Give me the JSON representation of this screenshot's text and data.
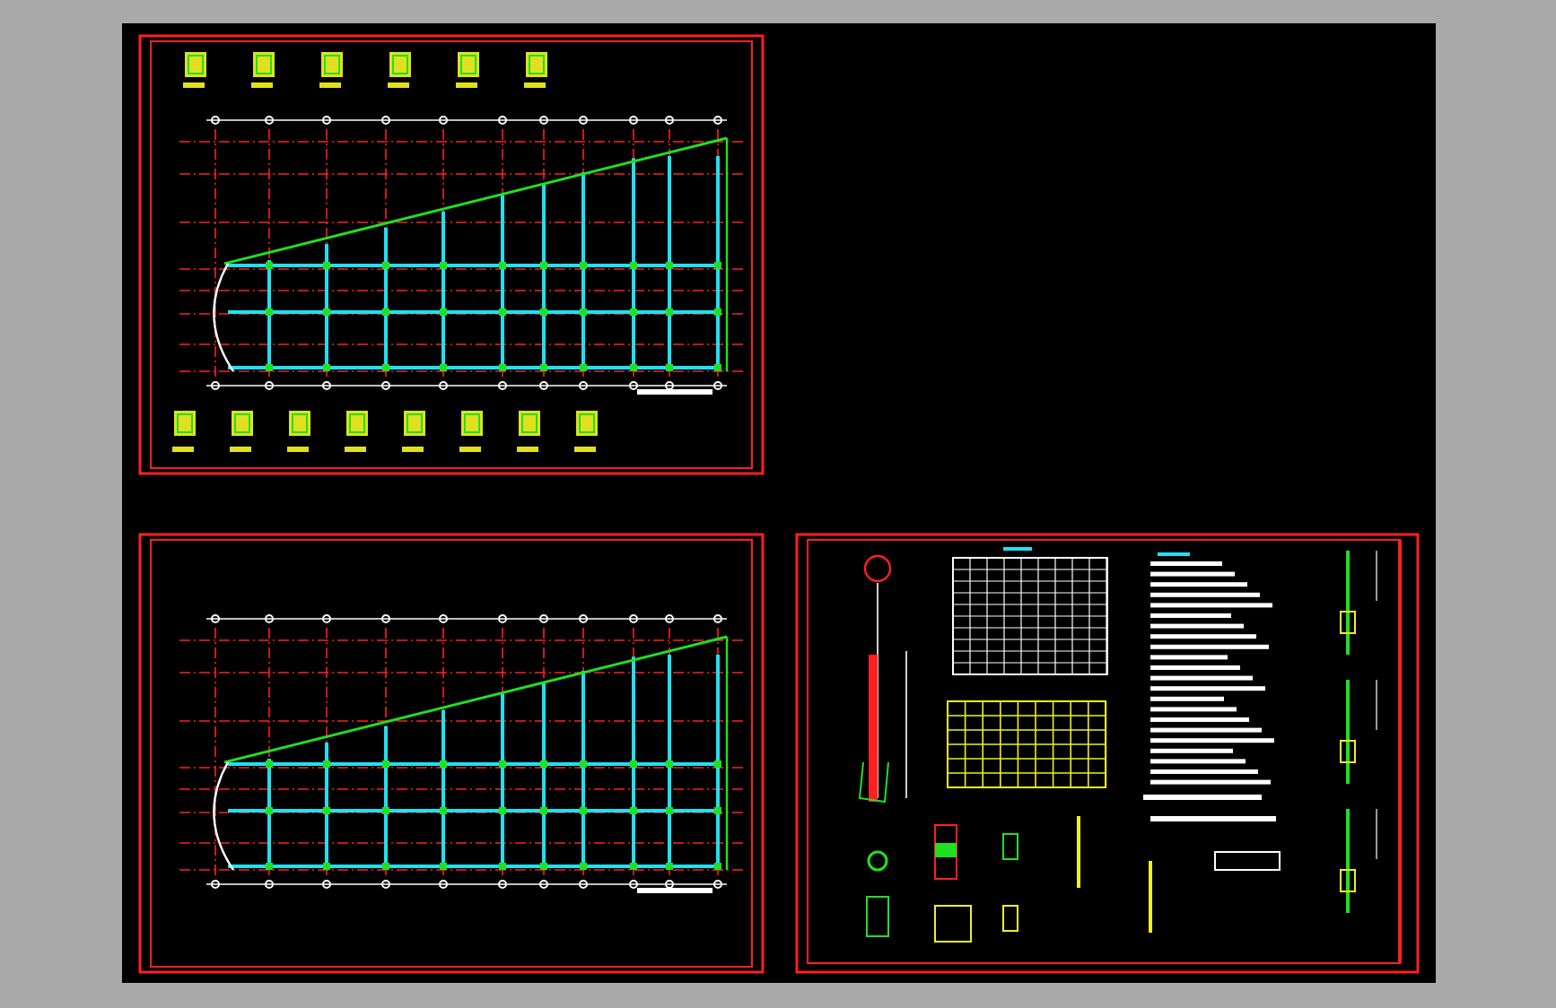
{
  "sheets": [
    {
      "kind": "plan-with-sections"
    },
    {
      "kind": "floor-plan"
    },
    {
      "kind": "detail-sheet"
    }
  ]
}
